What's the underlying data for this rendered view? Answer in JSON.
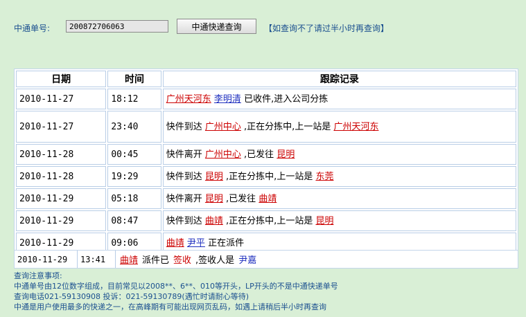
{
  "search": {
    "label": "中通单号:",
    "value": "200872706063",
    "button": "中通快递查询",
    "hint": "【如查询不了请过半小时再查询】"
  },
  "table": {
    "headers": [
      "日期",
      "时间",
      "跟踪记录"
    ],
    "rows": [
      {
        "date": "2010-11-27",
        "time": "18:12",
        "parts": [
          {
            "t": "广州天河东",
            "k": "place"
          },
          {
            "t": " ",
            "k": "sp"
          },
          {
            "t": "李明清",
            "k": "person"
          },
          {
            "t": " 已收件,进入公司分拣",
            "k": "text"
          }
        ]
      },
      {
        "date": "2010-11-27",
        "time": "23:40",
        "parts": [
          {
            "t": "快件到达 ",
            "k": "text"
          },
          {
            "t": "广州中心",
            "k": "place"
          },
          {
            "t": " ,正在分拣中,上一站是 ",
            "k": "text"
          },
          {
            "t": "广州天河东",
            "k": "place"
          }
        ]
      },
      {
        "date": "2010-11-28",
        "time": "00:45",
        "parts": [
          {
            "t": "快件离开 ",
            "k": "text"
          },
          {
            "t": "广州中心",
            "k": "place"
          },
          {
            "t": " ,已发往 ",
            "k": "text"
          },
          {
            "t": "昆明",
            "k": "place"
          }
        ]
      },
      {
        "date": "2010-11-28",
        "time": "19:29",
        "parts": [
          {
            "t": "快件到达 ",
            "k": "text"
          },
          {
            "t": "昆明",
            "k": "place"
          },
          {
            "t": " ,正在分拣中,上一站是 ",
            "k": "text"
          },
          {
            "t": "东莞",
            "k": "place"
          }
        ]
      },
      {
        "date": "2010-11-29",
        "time": "05:18",
        "parts": [
          {
            "t": "快件离开 ",
            "k": "text"
          },
          {
            "t": "昆明",
            "k": "place"
          },
          {
            "t": " ,已发往 ",
            "k": "text"
          },
          {
            "t": "曲靖",
            "k": "place"
          }
        ]
      },
      {
        "date": "2010-11-29",
        "time": "08:47",
        "parts": [
          {
            "t": "快件到达 ",
            "k": "text"
          },
          {
            "t": "曲靖",
            "k": "place"
          },
          {
            "t": " ,正在分拣中,上一站是 ",
            "k": "text"
          },
          {
            "t": "昆明",
            "k": "place"
          }
        ]
      },
      {
        "date": "2010-11-29",
        "time": "09:06",
        "parts": [
          {
            "t": "曲靖",
            "k": "place"
          },
          {
            "t": " ",
            "k": "sp"
          },
          {
            "t": "尹平",
            "k": "person"
          },
          {
            "t": " 正在派件",
            "k": "text"
          }
        ]
      }
    ]
  },
  "sign": {
    "date": "2010-11-29",
    "time": "13:41",
    "place": "曲靖",
    "text1": "派件已",
    "status": "签收",
    "text2": ",签收人是",
    "person": "尹嘉"
  },
  "notes": [
    "查询注意事项:",
    "中通单号由12位数字组成，目前常见以2008**、6**、010等开头，LP开头的不是中通快递单号",
    "查询电话021-59130908 投诉：021-59130789(遇忙时请耐心等待)",
    "中通是用户使用最多的快递之一，在高峰期有可能出现网页乱码，如遇上请稍后半小时再查询"
  ],
  "colors": {
    "place": "#cc0000",
    "person": "#1e2fbf",
    "label": "#1a4f8f",
    "background": "#d9efd6"
  }
}
